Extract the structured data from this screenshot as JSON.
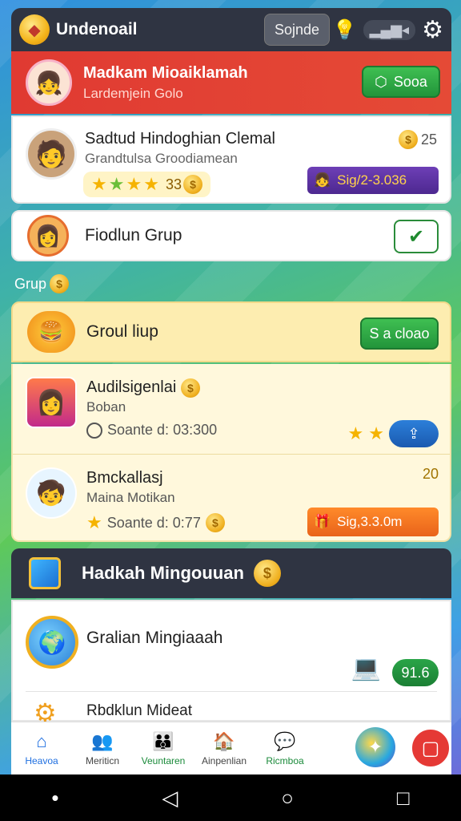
{
  "header": {
    "title": "Undenoail",
    "button": "Sojnde"
  },
  "promo": {
    "title": "Madkam Mioaiklamah",
    "subtitle": "Lardemjein Golo",
    "button": "Sooa"
  },
  "profile": {
    "name": "Sadtud Hindoghian Clemal",
    "subtitle": "Grandtulsa Groodiamean",
    "rating": "33",
    "count": "25",
    "badge": "Sig/2-3.036"
  },
  "fiend": {
    "title": "Fiodlun Grup"
  },
  "section_label": "Grup",
  "group": {
    "title": "Groul liup",
    "button": "S a cloao",
    "items": [
      {
        "title": "Audilsigenlai",
        "subtitle": "Boban",
        "meta": "Soante d: 03:300"
      },
      {
        "title": "Bmckallasj",
        "subtitle": "Maina Motikan",
        "meta": "Soante d: 0:77",
        "number": "20",
        "badge": "Sig,3.3.0m"
      }
    ]
  },
  "dark_section": {
    "title": "Hadkah Mingouuan"
  },
  "bottom": {
    "title": "Gralian Mingiaaah",
    "value": "91.6",
    "title2": "Rbdklun Mideat"
  },
  "nav": {
    "items": [
      {
        "label": "Heavoa",
        "icon": "home-icon"
      },
      {
        "label": "Meriticn",
        "icon": "people-icon"
      },
      {
        "label": "Veuntaren",
        "icon": "group-icon"
      },
      {
        "label": "Ainpenlian",
        "icon": "shop-icon"
      },
      {
        "label": "Ricmboa",
        "icon": "chat-icon"
      }
    ]
  },
  "colors": {
    "accent": "#1f6fe0",
    "red": "#e03a32",
    "green": "#22943a",
    "dark": "#2f3442"
  }
}
